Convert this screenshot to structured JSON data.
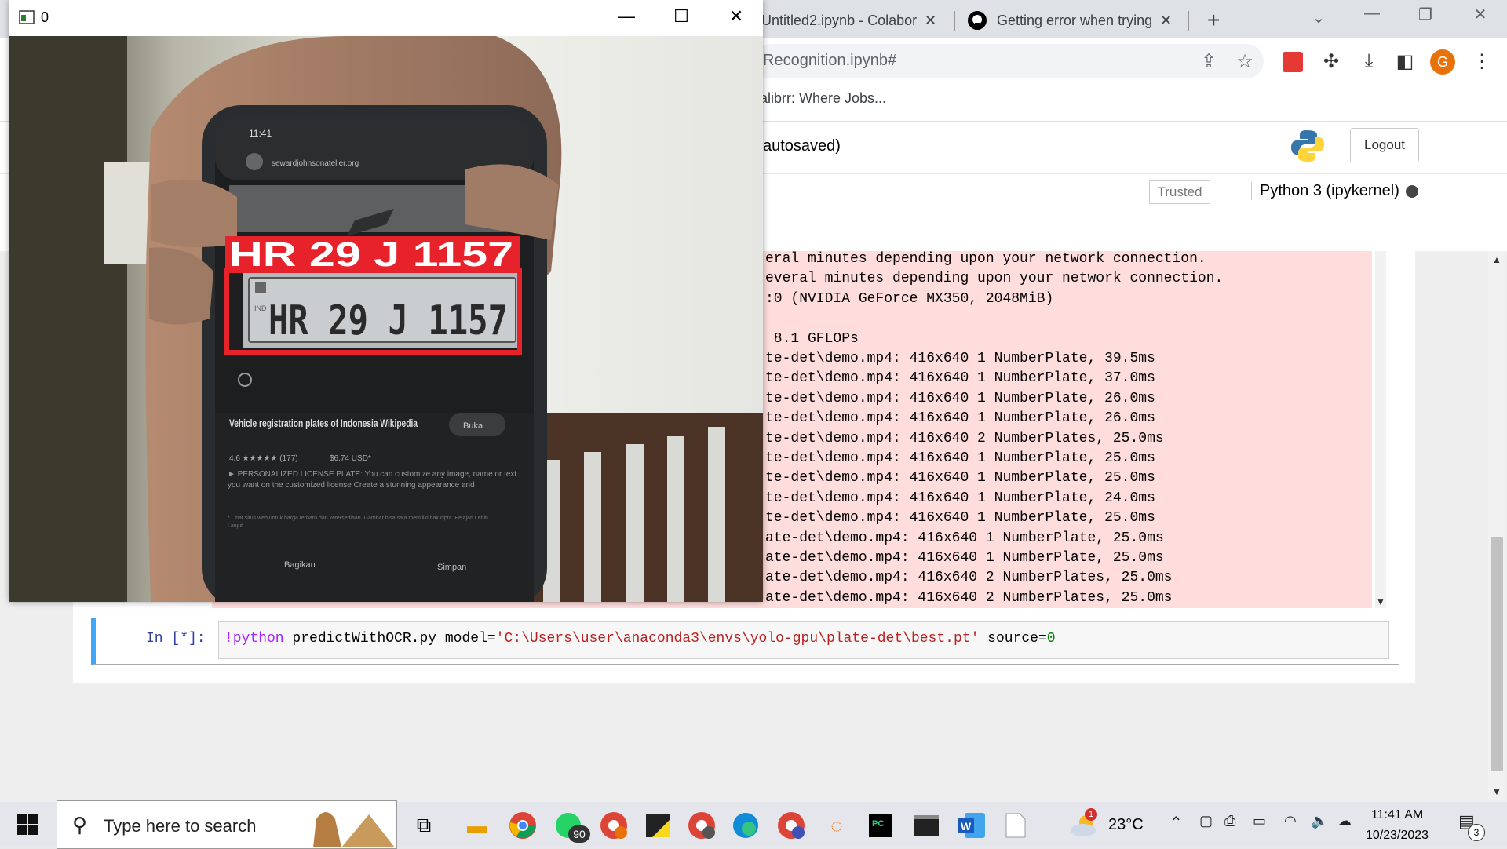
{
  "browser": {
    "tabs": [
      {
        "title": "Untitled2.ipynb - Colabor"
      },
      {
        "title": "Getting error when trying"
      }
    ],
    "new_tab": "+",
    "url": "Recognition.ipynb#",
    "bookmark": "alibrr: Where Jobs...",
    "profile_initial": "G"
  },
  "jupyter": {
    "notebook_title": "autosaved)",
    "logout": "Logout",
    "trusted": "Trusted",
    "kernel": "Python 3 (ipykernel)",
    "output_lines": [
      "eral minutes depending upon your network connection.",
      "everal minutes depending upon your network connection.",
      ":0 (NVIDIA GeForce MX350, 2048MiB)",
      "",
      " 8.1 GFLOPs",
      "te-det\\demo.mp4: 416x640 1 NumberPlate, 39.5ms",
      "te-det\\demo.mp4: 416x640 1 NumberPlate, 37.0ms",
      "te-det\\demo.mp4: 416x640 1 NumberPlate, 26.0ms",
      "te-det\\demo.mp4: 416x640 1 NumberPlate, 26.0ms",
      "te-det\\demo.mp4: 416x640 2 NumberPlates, 25.0ms",
      "te-det\\demo.mp4: 416x640 1 NumberPlate, 25.0ms",
      "te-det\\demo.mp4: 416x640 1 NumberPlate, 25.0ms",
      "te-det\\demo.mp4: 416x640 1 NumberPlate, 24.0ms",
      "te-det\\demo.mp4: 416x640 1 NumberPlate, 25.0ms",
      "ate-det\\demo.mp4: 416x640 1 NumberPlate, 25.0ms",
      "ate-det\\demo.mp4: 416x640 1 NumberPlate, 25.0ms",
      "ate-det\\demo.mp4: 416x640 2 NumberPlates, 25.0ms",
      "ate-det\\demo.mp4: 416x640 2 NumberPlates, 25.0ms"
    ],
    "prompt": "In [*]:",
    "code_cmd": "!python",
    "code_mid": " predictWithOCR.py model=",
    "code_str": "'C:\\Users\\user\\anaconda3\\envs\\yolo-gpu\\plate-det\\best.pt'",
    "code_src": " source=",
    "code_num": "0"
  },
  "cv_window": {
    "title": "0",
    "detection_label": "HR 29 J 1157",
    "plate_text": "HR 29 J 1157",
    "plate_prefix": "IND",
    "phone": {
      "status_time": "11:41",
      "site": "sewardjohnsonatelier.org",
      "heading": "Vehicle registration plates of Indonesia Wikipedia",
      "buka": "Buka",
      "rating": "4.6 ★★★★★ (177)",
      "price": "$6.74 USD*",
      "promo": "► PERSONALIZED LICENSE PLATE: You can customize any image, name or text you want on the customized license Create a stunning appearance and",
      "note": "* Lihat situs web untuk harga terbaru dan ketersediaan. Gambar bisa saja memiliki hak cipta. Pelajari Lebih Lanjut",
      "share": "Bagikan",
      "save": "Simpan"
    }
  },
  "taskbar": {
    "search_placeholder": "Type here to search",
    "whatsapp_badge": "90",
    "weather_temp": "23°C",
    "weather_badge": "1",
    "time": "11:41 AM",
    "date": "10/23/2023",
    "notification_count": "3"
  }
}
